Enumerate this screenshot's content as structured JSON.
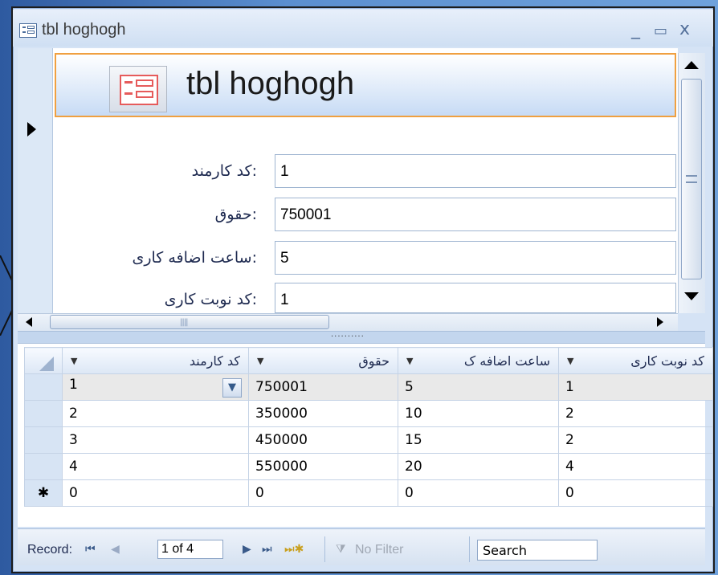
{
  "window": {
    "title": "tbl hoghogh",
    "minimize": "_",
    "maximize": "▭",
    "close": "x"
  },
  "form": {
    "title": "tbl hoghogh",
    "fields": [
      {
        "label": "کد کارمند:",
        "value": "1"
      },
      {
        "label": "حقوق:",
        "value": "750001"
      },
      {
        "label": "ساعت اضافه کاری:",
        "value": "5"
      },
      {
        "label": "کد نوبت کاری:",
        "value": "1"
      }
    ]
  },
  "datasheet": {
    "columns": [
      "کد کارمند",
      "حقوق",
      "ساعت اضافه ک",
      "کد نوبت کاری"
    ],
    "rows": [
      [
        "1",
        "750001",
        "5",
        "1"
      ],
      [
        "2",
        "350000",
        "10",
        "2"
      ],
      [
        "3",
        "450000",
        "15",
        "2"
      ],
      [
        "4",
        "550000",
        "20",
        "4"
      ],
      [
        "0",
        "0",
        "0",
        "0"
      ]
    ],
    "new_row_marker": "✱"
  },
  "navigation": {
    "record_label": "Record:",
    "current": "1 of 4",
    "no_filter": "No Filter",
    "search": "Search"
  }
}
